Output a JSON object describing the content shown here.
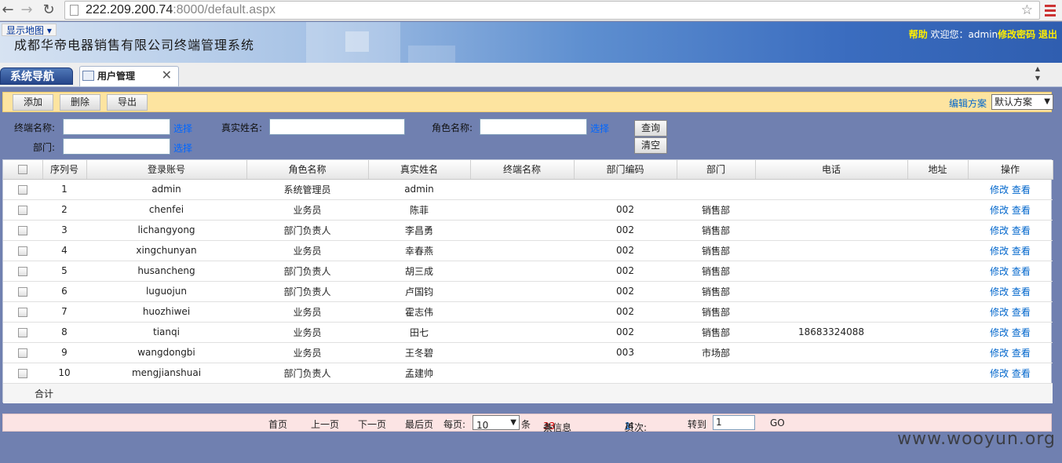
{
  "browser": {
    "url_host": "222.209.200.74",
    "url_rest": ":8000/default.aspx"
  },
  "header": {
    "map_button": "显示地图",
    "system_title": "成都华帝电器销售有限公司终端管理系统",
    "help": "帮助",
    "welcome": "欢迎您：admin",
    "change_password": "修改密码",
    "logout": "退出"
  },
  "tabs": {
    "nav": "系统导航",
    "active": "用户管理"
  },
  "toolbar": {
    "add": "添加",
    "delete": "删除",
    "export": "导出",
    "edit_scheme": "编辑方案",
    "scheme_value": "默认方案"
  },
  "filters": {
    "terminal_label": "终端名称:",
    "realname_label": "真实姓名:",
    "role_label": "角色名称:",
    "dept_label": "部门:",
    "choose": "选择",
    "query": "查询",
    "clear": "清空"
  },
  "table": {
    "columns": [
      "序列号",
      "登录账号",
      "角色名称",
      "真实姓名",
      "终端名称",
      "部门编码",
      "部门",
      "电话",
      "地址",
      "操作"
    ],
    "edit": "修改",
    "view": "查看",
    "rows": [
      {
        "no": "1",
        "account": "admin",
        "role": "系统管理员",
        "name": "admin",
        "terminal": "",
        "dept_code": "",
        "dept": "",
        "phone": "",
        "address": ""
      },
      {
        "no": "2",
        "account": "chenfei",
        "role": "业务员",
        "name": "陈菲",
        "terminal": "",
        "dept_code": "002",
        "dept": "销售部",
        "phone": "",
        "address": ""
      },
      {
        "no": "3",
        "account": "lichangyong",
        "role": "部门负责人",
        "name": "李昌勇",
        "terminal": "",
        "dept_code": "002",
        "dept": "销售部",
        "phone": "",
        "address": ""
      },
      {
        "no": "4",
        "account": "xingchunyan",
        "role": "业务员",
        "name": "幸春燕",
        "terminal": "",
        "dept_code": "002",
        "dept": "销售部",
        "phone": "",
        "address": ""
      },
      {
        "no": "5",
        "account": "husancheng",
        "role": "部门负责人",
        "name": "胡三成",
        "terminal": "",
        "dept_code": "002",
        "dept": "销售部",
        "phone": "",
        "address": ""
      },
      {
        "no": "6",
        "account": "luguojun",
        "role": "部门负责人",
        "name": "卢国钧",
        "terminal": "",
        "dept_code": "002",
        "dept": "销售部",
        "phone": "",
        "address": ""
      },
      {
        "no": "7",
        "account": "huozhiwei",
        "role": "业务员",
        "name": "霍志伟",
        "terminal": "",
        "dept_code": "002",
        "dept": "销售部",
        "phone": "",
        "address": ""
      },
      {
        "no": "8",
        "account": "tianqi",
        "role": "业务员",
        "name": "田七",
        "terminal": "",
        "dept_code": "002",
        "dept": "销售部",
        "phone": "18683324088",
        "address": ""
      },
      {
        "no": "9",
        "account": "wangdongbi",
        "role": "业务员",
        "name": "王冬碧",
        "terminal": "",
        "dept_code": "003",
        "dept": "市场部",
        "phone": "",
        "address": ""
      },
      {
        "no": "10",
        "account": "mengjianshuai",
        "role": "部门负责人",
        "name": "孟建帅",
        "terminal": "",
        "dept_code": "",
        "dept": "",
        "phone": "",
        "address": ""
      }
    ],
    "total_label": "合计"
  },
  "pager": {
    "first": "首页",
    "prev": "上一页",
    "next": "下一页",
    "last": "最后页",
    "per_page_label": "每页:",
    "per_page_value": "10",
    "unit": "条",
    "total_prefix": "共",
    "total_count": "33",
    "total_suffix": "条信息",
    "page_label": "页次:",
    "page_current": "1",
    "page_total": "/4",
    "goto_label": "转到",
    "goto_value": "1",
    "go": "GO"
  },
  "watermark": "www.wooyun.org"
}
